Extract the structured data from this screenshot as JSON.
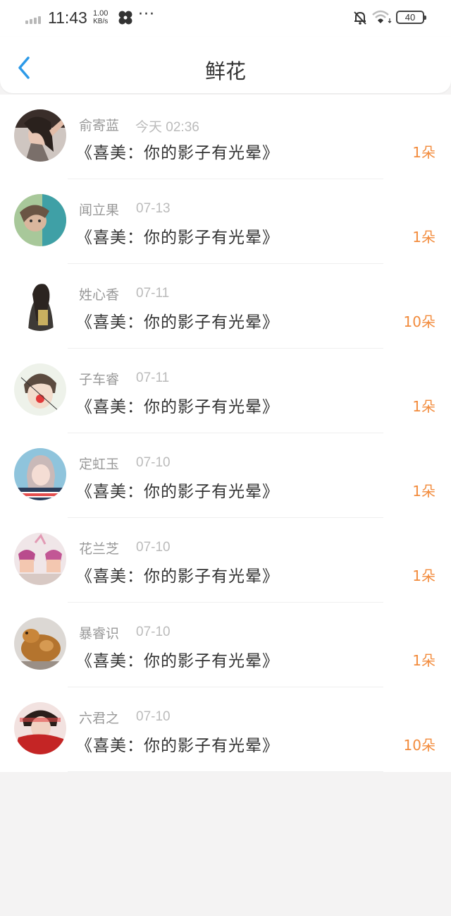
{
  "status_bar": {
    "time": "11:43",
    "net_speed_value": "1.00",
    "net_speed_unit": "KB/s",
    "more": "···",
    "battery": "40"
  },
  "nav": {
    "back_icon": "chevron-left-icon",
    "title": "鲜花"
  },
  "items": [
    {
      "name": "俞寄蓝",
      "date": "今天 02:36",
      "book": "《喜美：你的影子有光晕》",
      "count": "1朵"
    },
    {
      "name": "闻立果",
      "date": "07-13",
      "book": "《喜美：你的影子有光晕》",
      "count": "1朵"
    },
    {
      "name": "姓心香",
      "date": "07-11",
      "book": "《喜美：你的影子有光晕》",
      "count": "10朵"
    },
    {
      "name": "子车睿",
      "date": "07-11",
      "book": "《喜美：你的影子有光晕》",
      "count": "1朵"
    },
    {
      "name": "定虹玉",
      "date": "07-10",
      "book": "《喜美：你的影子有光晕》",
      "count": "1朵"
    },
    {
      "name": "花兰芝",
      "date": "07-10",
      "book": "《喜美：你的影子有光晕》",
      "count": "1朵"
    },
    {
      "name": "暴睿识",
      "date": "07-10",
      "book": "《喜美：你的影子有光晕》",
      "count": "1朵"
    },
    {
      "name": "六君之",
      "date": "07-10",
      "book": "《喜美：你的影子有光晕》",
      "count": "10朵"
    }
  ],
  "colors": {
    "accent": "#2d9ae8",
    "count": "#f28b3c"
  }
}
